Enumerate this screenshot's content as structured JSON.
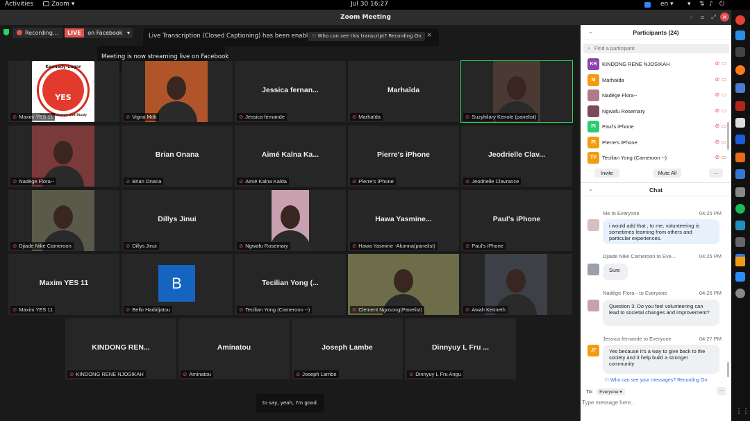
{
  "topbar": {
    "activities": "Activities",
    "app": "Zoom",
    "app_caret": "▾",
    "clock": "Jul 30  16:27",
    "lang": "en",
    "lang_caret": "▾"
  },
  "window": {
    "title": "Zoom Meeting",
    "close_glyph": "×"
  },
  "status": {
    "recording": "Recording...",
    "live_badge": "LIVE",
    "live_target": "on Facebook",
    "caption_notice": "Live Transcription (Closed Captioning) has been enabled",
    "transcript_link": "Who can see this transcript? Recording On",
    "streaming_tooltip": "Meeting is now streaming live on Facebook"
  },
  "tiles": [
    {
      "label": "Maxim YES 11"
    },
    {
      "label": "Vigna Mdk"
    },
    {
      "name": "Jessica fernan...",
      "label": "Jessica fernande"
    },
    {
      "name": "Marhaïda",
      "label": "Marhaïda"
    },
    {
      "label": "Suzyhilary Kenole (panelist)"
    },
    {
      "label": "Nadège Flora--"
    },
    {
      "name": "Brian Onana",
      "label": "Brian Onana"
    },
    {
      "name": "Aimé Kalna Ka...",
      "label": "Aimé Kalna Kalda"
    },
    {
      "name": "Pierre's iPhone",
      "label": "Pierre's iPhone"
    },
    {
      "name": "Jeodrielle Clav...",
      "label": "Jeodrielle Clavrance"
    },
    {
      "label": "Djiade Nike Cameroon"
    },
    {
      "name": "Dillys Jinui",
      "label": "Dillys Jinui"
    },
    {
      "label": "Ngwafu Rosemary"
    },
    {
      "name": "Hawa Yasmine...",
      "label": "Hawa Yasmine -Alumna(panelist)"
    },
    {
      "name": "Paul's iPhone",
      "label": "Paul's iPhone"
    },
    {
      "name": "Maxim YES 11",
      "label": "Maxim YES 11"
    },
    {
      "label": "Bello Hadidjatou",
      "initial": "B"
    },
    {
      "name": "Tecilian Yong (...",
      "label": "Tecilian Yong (Cameroon --)"
    },
    {
      "label": "Clement Ngosong(Panelist)"
    },
    {
      "label": "Awah Kenneth"
    },
    {
      "name": "KINDONG REN...",
      "label": "KINDONG RENE NJOSIKAH"
    },
    {
      "name": "Aminatou",
      "label": "Aminatou"
    },
    {
      "name": "Joseph Lambe",
      "label": "Joseph Lambe"
    },
    {
      "name": "Dinnyuy L Fru ...",
      "label": "Dinnyuy L Fru Angu"
    }
  ],
  "logo": {
    "text_top": "Kennedy-Lugar",
    "text_center": "YES",
    "text_bottom": "Youth Exchange and Study"
  },
  "caption": "to say, yeah, I'm good.",
  "participants": {
    "title": "Participants (24)",
    "search_placeholder": "Find a participant",
    "list": [
      {
        "initials": "KR",
        "name": "KINDONG RENE NJOSIKAH",
        "color": "#8e44ad"
      },
      {
        "initials": "M",
        "name": "Marhaïda",
        "color": "#f39c12"
      },
      {
        "initials": "",
        "name": "Nadège Flora--",
        "color": "#b07a8a"
      },
      {
        "initials": "",
        "name": "Ngwafu Rosemary",
        "color": "#7a4a5a"
      },
      {
        "initials": "PI",
        "name": "Paul's iPhone",
        "color": "#2ecc71"
      },
      {
        "initials": "PI",
        "name": "Pierre's iPhone",
        "color": "#f39c12"
      },
      {
        "initials": "TY",
        "name": "Tecilian Yong (Cameroon --)",
        "color": "#f39c12"
      }
    ],
    "invite": "Invite",
    "mute_all": "Mute All",
    "more": "..."
  },
  "chat": {
    "title": "Chat",
    "messages": [
      {
        "meta": "Me to Everyone",
        "time": "04:25 PM",
        "text": "i would add that , to me, volunteering is sometimes learning from others and particular experiences."
      },
      {
        "meta": "Djiade Nike Cameroon to Eve...",
        "time": "04:25 PM",
        "text": "Sure"
      },
      {
        "meta": "Nadège Flora-- to Everyone",
        "time": "04:26 PM",
        "text": "Question 3: Do you feel volunteering can lead to societal changes and improvement?"
      },
      {
        "meta": "Jessica fernande to Everyone",
        "time": "04:27 PM",
        "text": "Yes because it's a way to give back to the society and it help build a stronger community",
        "initials": "JF"
      }
    ],
    "recording_note": "Who can see your messages? Recording On",
    "to_label": "To:",
    "to_value": "Everyone",
    "input_placeholder": "Type message here...",
    "more": "..."
  }
}
